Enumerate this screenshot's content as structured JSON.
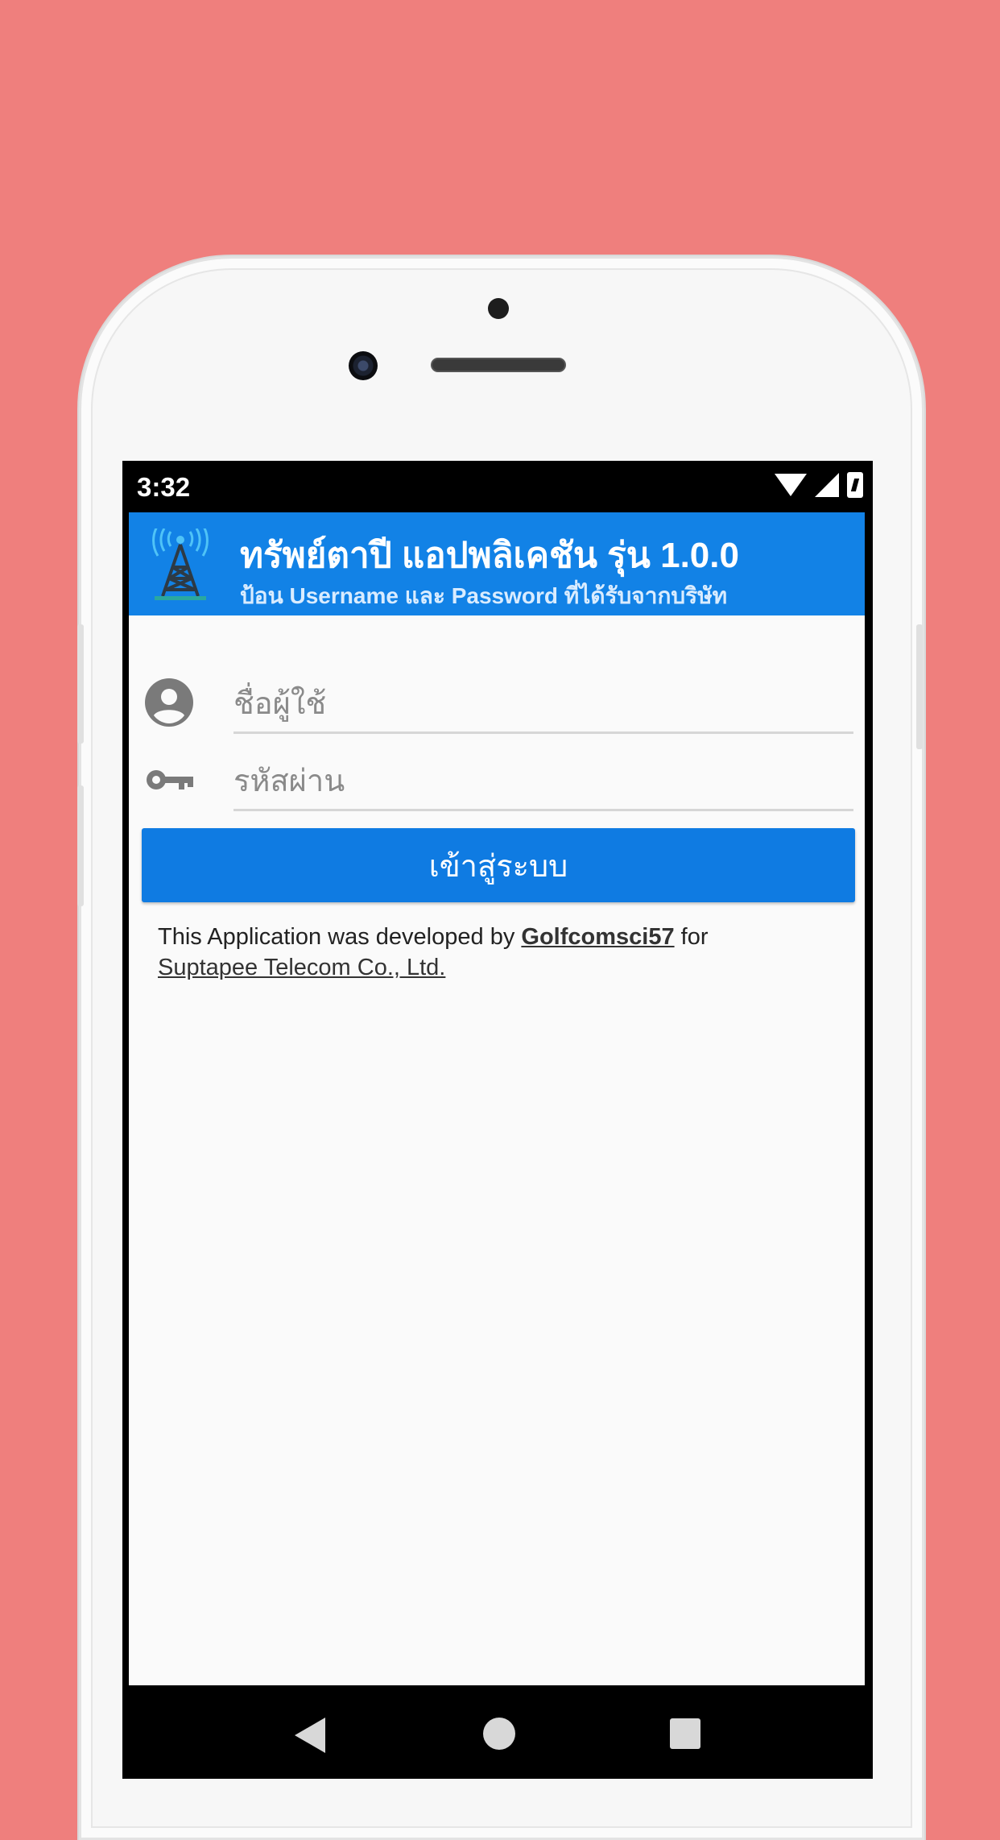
{
  "status_bar": {
    "time": "3:32"
  },
  "app_bar": {
    "title": "ทรัพย์ตาปี แอปพลิเคชัน รุ่น 1.0.0",
    "subtitle": "ป้อน Username และ Password ที่ได้รับจากบริษัท",
    "logo_icon": "cell-tower-icon"
  },
  "login_form": {
    "username_placeholder": "ชื่อผู้ใช้",
    "username_value": "",
    "password_placeholder": "รหัสผ่าน",
    "password_value": "",
    "login_button_label": "เข้าสู่ระบบ"
  },
  "credits": {
    "text_before": "This Application was developed by",
    "developer_link": "Golfcomsci57",
    "text_middle": "for",
    "company_link": "Suptapee Telecom Co., Ltd."
  },
  "nav_bar": {
    "back_icon": "back-triangle-icon",
    "home_icon": "home-circle-icon",
    "recents_icon": "recents-square-icon"
  },
  "colors": {
    "background": "#ef7f7d",
    "app_bar": "#1282e6",
    "primary_button": "#0f7be2"
  }
}
